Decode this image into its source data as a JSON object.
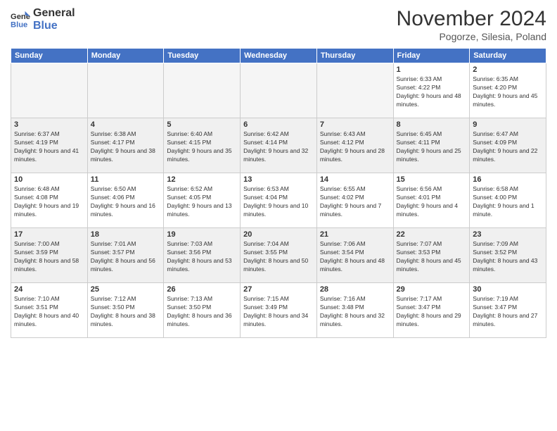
{
  "header": {
    "logo_line1": "General",
    "logo_line2": "Blue",
    "month": "November 2024",
    "location": "Pogorze, Silesia, Poland"
  },
  "weekdays": [
    "Sunday",
    "Monday",
    "Tuesday",
    "Wednesday",
    "Thursday",
    "Friday",
    "Saturday"
  ],
  "weeks": [
    [
      {
        "day": "",
        "info": ""
      },
      {
        "day": "",
        "info": ""
      },
      {
        "day": "",
        "info": ""
      },
      {
        "day": "",
        "info": ""
      },
      {
        "day": "",
        "info": ""
      },
      {
        "day": "1",
        "info": "Sunrise: 6:33 AM\nSunset: 4:22 PM\nDaylight: 9 hours and 48 minutes."
      },
      {
        "day": "2",
        "info": "Sunrise: 6:35 AM\nSunset: 4:20 PM\nDaylight: 9 hours and 45 minutes."
      }
    ],
    [
      {
        "day": "3",
        "info": "Sunrise: 6:37 AM\nSunset: 4:19 PM\nDaylight: 9 hours and 41 minutes."
      },
      {
        "day": "4",
        "info": "Sunrise: 6:38 AM\nSunset: 4:17 PM\nDaylight: 9 hours and 38 minutes."
      },
      {
        "day": "5",
        "info": "Sunrise: 6:40 AM\nSunset: 4:15 PM\nDaylight: 9 hours and 35 minutes."
      },
      {
        "day": "6",
        "info": "Sunrise: 6:42 AM\nSunset: 4:14 PM\nDaylight: 9 hours and 32 minutes."
      },
      {
        "day": "7",
        "info": "Sunrise: 6:43 AM\nSunset: 4:12 PM\nDaylight: 9 hours and 28 minutes."
      },
      {
        "day": "8",
        "info": "Sunrise: 6:45 AM\nSunset: 4:11 PM\nDaylight: 9 hours and 25 minutes."
      },
      {
        "day": "9",
        "info": "Sunrise: 6:47 AM\nSunset: 4:09 PM\nDaylight: 9 hours and 22 minutes."
      }
    ],
    [
      {
        "day": "10",
        "info": "Sunrise: 6:48 AM\nSunset: 4:08 PM\nDaylight: 9 hours and 19 minutes."
      },
      {
        "day": "11",
        "info": "Sunrise: 6:50 AM\nSunset: 4:06 PM\nDaylight: 9 hours and 16 minutes."
      },
      {
        "day": "12",
        "info": "Sunrise: 6:52 AM\nSunset: 4:05 PM\nDaylight: 9 hours and 13 minutes."
      },
      {
        "day": "13",
        "info": "Sunrise: 6:53 AM\nSunset: 4:04 PM\nDaylight: 9 hours and 10 minutes."
      },
      {
        "day": "14",
        "info": "Sunrise: 6:55 AM\nSunset: 4:02 PM\nDaylight: 9 hours and 7 minutes."
      },
      {
        "day": "15",
        "info": "Sunrise: 6:56 AM\nSunset: 4:01 PM\nDaylight: 9 hours and 4 minutes."
      },
      {
        "day": "16",
        "info": "Sunrise: 6:58 AM\nSunset: 4:00 PM\nDaylight: 9 hours and 1 minute."
      }
    ],
    [
      {
        "day": "17",
        "info": "Sunrise: 7:00 AM\nSunset: 3:59 PM\nDaylight: 8 hours and 58 minutes."
      },
      {
        "day": "18",
        "info": "Sunrise: 7:01 AM\nSunset: 3:57 PM\nDaylight: 8 hours and 56 minutes."
      },
      {
        "day": "19",
        "info": "Sunrise: 7:03 AM\nSunset: 3:56 PM\nDaylight: 8 hours and 53 minutes."
      },
      {
        "day": "20",
        "info": "Sunrise: 7:04 AM\nSunset: 3:55 PM\nDaylight: 8 hours and 50 minutes."
      },
      {
        "day": "21",
        "info": "Sunrise: 7:06 AM\nSunset: 3:54 PM\nDaylight: 8 hours and 48 minutes."
      },
      {
        "day": "22",
        "info": "Sunrise: 7:07 AM\nSunset: 3:53 PM\nDaylight: 8 hours and 45 minutes."
      },
      {
        "day": "23",
        "info": "Sunrise: 7:09 AM\nSunset: 3:52 PM\nDaylight: 8 hours and 43 minutes."
      }
    ],
    [
      {
        "day": "24",
        "info": "Sunrise: 7:10 AM\nSunset: 3:51 PM\nDaylight: 8 hours and 40 minutes."
      },
      {
        "day": "25",
        "info": "Sunrise: 7:12 AM\nSunset: 3:50 PM\nDaylight: 8 hours and 38 minutes."
      },
      {
        "day": "26",
        "info": "Sunrise: 7:13 AM\nSunset: 3:50 PM\nDaylight: 8 hours and 36 minutes."
      },
      {
        "day": "27",
        "info": "Sunrise: 7:15 AM\nSunset: 3:49 PM\nDaylight: 8 hours and 34 minutes."
      },
      {
        "day": "28",
        "info": "Sunrise: 7:16 AM\nSunset: 3:48 PM\nDaylight: 8 hours and 32 minutes."
      },
      {
        "day": "29",
        "info": "Sunrise: 7:17 AM\nSunset: 3:47 PM\nDaylight: 8 hours and 29 minutes."
      },
      {
        "day": "30",
        "info": "Sunrise: 7:19 AM\nSunset: 3:47 PM\nDaylight: 8 hours and 27 minutes."
      }
    ]
  ]
}
